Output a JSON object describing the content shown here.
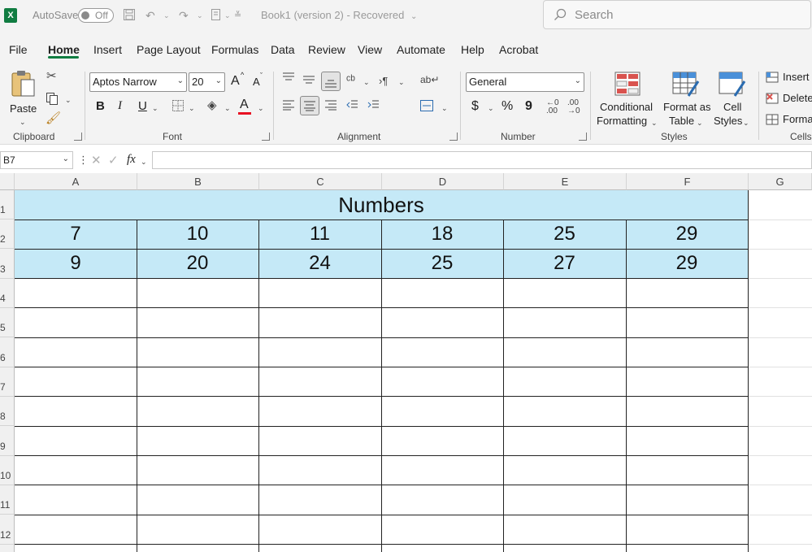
{
  "titlebar": {
    "app_letter": "X",
    "autosave_label": "AutoSave",
    "autosave_state": "Off",
    "document_title": "Book1 (version 2)  -  Recovered",
    "search_placeholder": "Search"
  },
  "menu": {
    "tabs": [
      "File",
      "Home",
      "Insert",
      "Page Layout",
      "Formulas",
      "Data",
      "Review",
      "View",
      "Automate",
      "Help",
      "Acrobat"
    ],
    "active_tab": "Home"
  },
  "ribbon": {
    "clipboard": {
      "label": "Clipboard",
      "paste_label": "Paste"
    },
    "font": {
      "label": "Font",
      "font_name": "Aptos Narrow",
      "font_size": "20",
      "bold": "B",
      "italic": "I",
      "underline": "U",
      "font_color_glyph": "A",
      "grow": "A",
      "shrink": "A",
      "font_color": "#e81123"
    },
    "alignment": {
      "label": "Alignment"
    },
    "number": {
      "label": "Number",
      "format": "General",
      "currency": "$",
      "percent": "%",
      "comma": "9"
    },
    "styles": {
      "label": "Styles",
      "conditional_1": "Conditional",
      "conditional_2": "Formatting",
      "format_table_1": "Format as",
      "format_table_2": "Table",
      "cell_styles_1": "Cell",
      "cell_styles_2": "Styles"
    },
    "cells": {
      "label": "Cells",
      "insert": "Insert",
      "delete": "Delete",
      "format": "Format"
    }
  },
  "formula_bar": {
    "name_box": "B7",
    "fx": "fx",
    "content": ""
  },
  "sheet": {
    "columns": [
      "A",
      "B",
      "C",
      "D",
      "E",
      "F",
      "G"
    ],
    "rows": [
      "1",
      "2",
      "3",
      "4",
      "5",
      "6",
      "7",
      "8",
      "9",
      "10",
      "11",
      "12"
    ],
    "title": "Numbers",
    "row2": [
      "7",
      "10",
      "11",
      "18",
      "25",
      "29"
    ],
    "row3": [
      "9",
      "20",
      "24",
      "25",
      "27",
      "29"
    ],
    "fill_color": "#c5e9f7"
  }
}
